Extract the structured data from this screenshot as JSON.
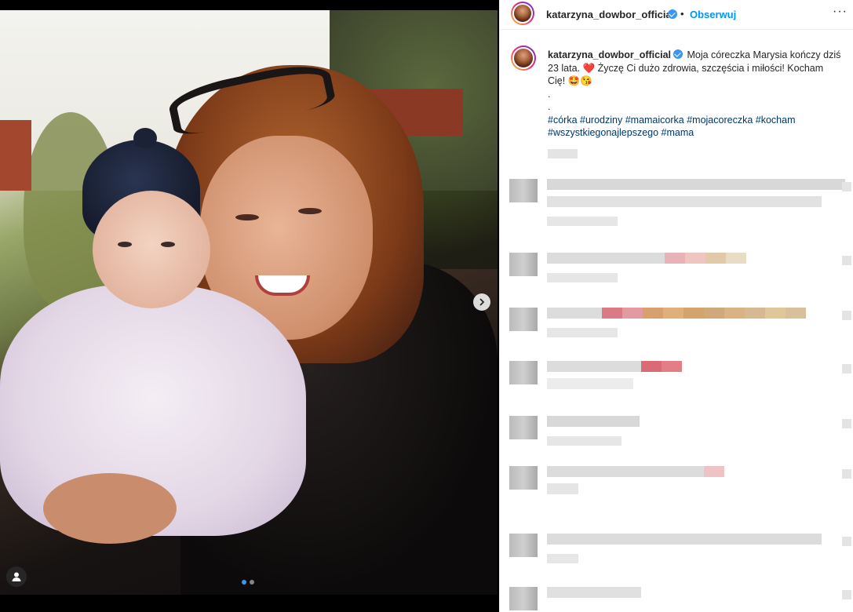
{
  "post": {
    "username": "katarzyna_dowbor_official",
    "follow_label": "Obserwuj",
    "separator": "•",
    "more_label": "···"
  },
  "caption": {
    "username": "katarzyna_dowbor_official",
    "text_1": "Moja córeczka Marysia kończy dziś 23 lata.",
    "heart": "❤️",
    "text_2": "Życzę Ci dużo zdrowia, szczęścia i miłości! Kocham Cię!",
    "emoji": "🤩😘",
    "dot1": ".",
    "dot2": ".",
    "hashtags": [
      "#córka",
      "#urodziny",
      "#mamaicorka",
      "#mojacoreczka",
      "#kocham",
      "#wszystkiegonajlepszego",
      "#mama"
    ]
  },
  "carousel": {
    "slides": 2,
    "current": 1
  },
  "icons": {
    "tag": "user-tag-icon",
    "next": "chevron-right-icon",
    "verified": "verified-badge-icon",
    "more": "more-options-icon"
  },
  "colors": {
    "link": "#00376b",
    "follow": "#0095f6",
    "verified": "#3897f0",
    "heart": "#ed4956"
  }
}
